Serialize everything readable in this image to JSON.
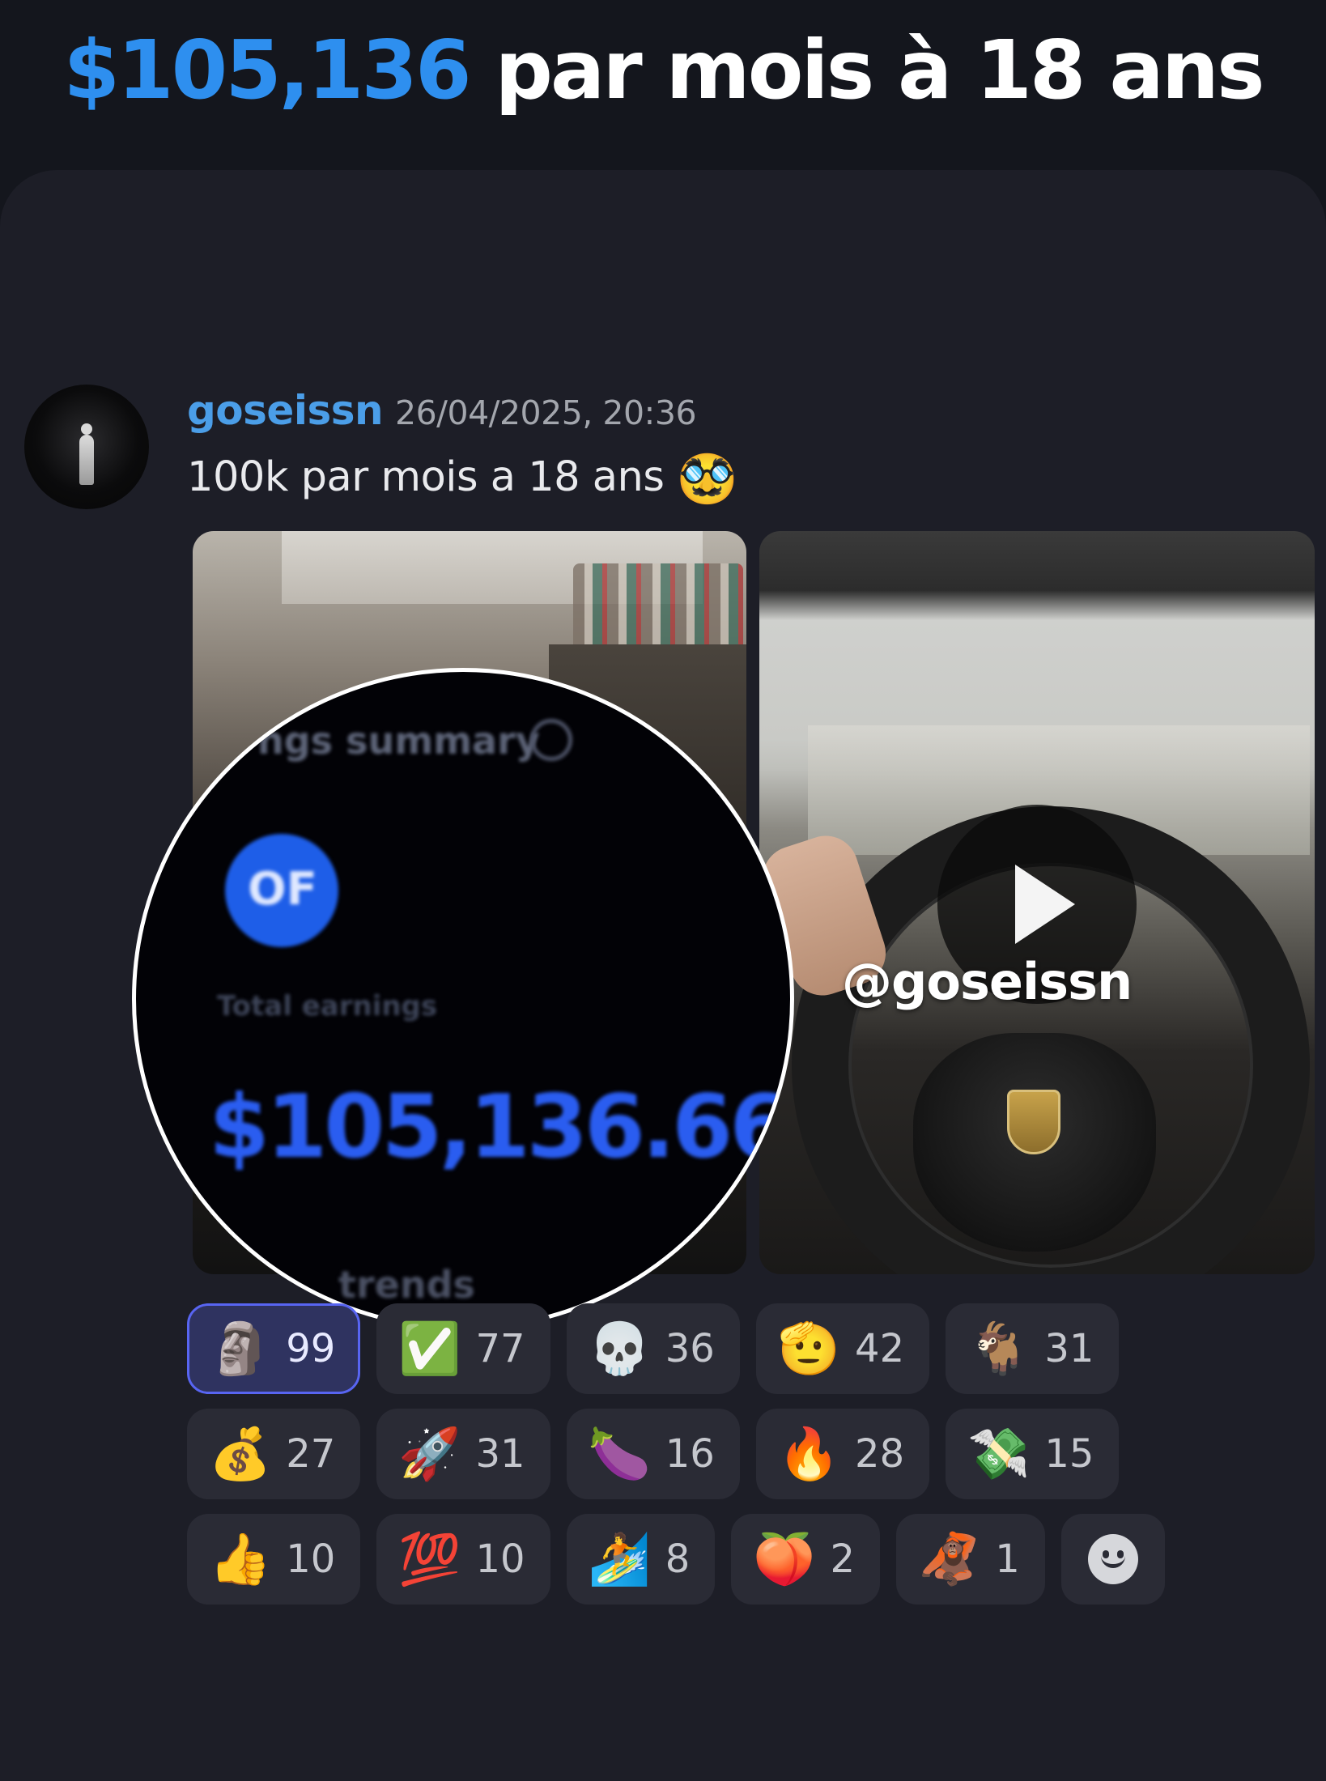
{
  "headline": {
    "amount": "$105,136",
    "rest": " par mois à 18 ans"
  },
  "message": {
    "username": "goseissn",
    "timestamp": "26/04/2025, 20:36",
    "text": "100k par mois a 18 ans ",
    "text_emoji": "🥸"
  },
  "media": {
    "zoom": {
      "summary_label": "ngs summary",
      "logo_text": "OF",
      "total_label": "Total earnings",
      "earnings_value": "$105,136.66",
      "trends_label": "trends"
    },
    "video": {
      "watermark": "@goseissn",
      "play_icon": "play-icon"
    }
  },
  "reactions": [
    {
      "emoji": "🗿",
      "count": "99",
      "active": true
    },
    {
      "emoji": "✅",
      "count": "77",
      "active": false
    },
    {
      "emoji": "💀",
      "count": "36",
      "active": false
    },
    {
      "emoji": "🫡",
      "count": "42",
      "active": false
    },
    {
      "emoji": "🐐",
      "count": "31",
      "active": false
    },
    {
      "emoji": "💰",
      "count": "27",
      "active": false
    },
    {
      "emoji": "🚀",
      "count": "31",
      "active": false
    },
    {
      "emoji": "🍆",
      "count": "16",
      "active": false
    },
    {
      "emoji": "🔥",
      "count": "28",
      "active": false
    },
    {
      "emoji": "💸",
      "count": "15",
      "active": false
    },
    {
      "emoji": "👍",
      "count": "10",
      "active": false
    },
    {
      "emoji": "💯",
      "count": "10",
      "active": false
    },
    {
      "emoji": "🏄",
      "count": "8",
      "active": false
    },
    {
      "emoji": "🍑",
      "count": "2",
      "active": false
    },
    {
      "emoji": "🦧",
      "count": "1",
      "active": false
    }
  ],
  "colors": {
    "accent_blue": "#2e8fef",
    "username_blue": "#4b9ee8",
    "active_reaction_border": "#5865f2",
    "background": "#14161d",
    "card": "#1d1e27"
  }
}
